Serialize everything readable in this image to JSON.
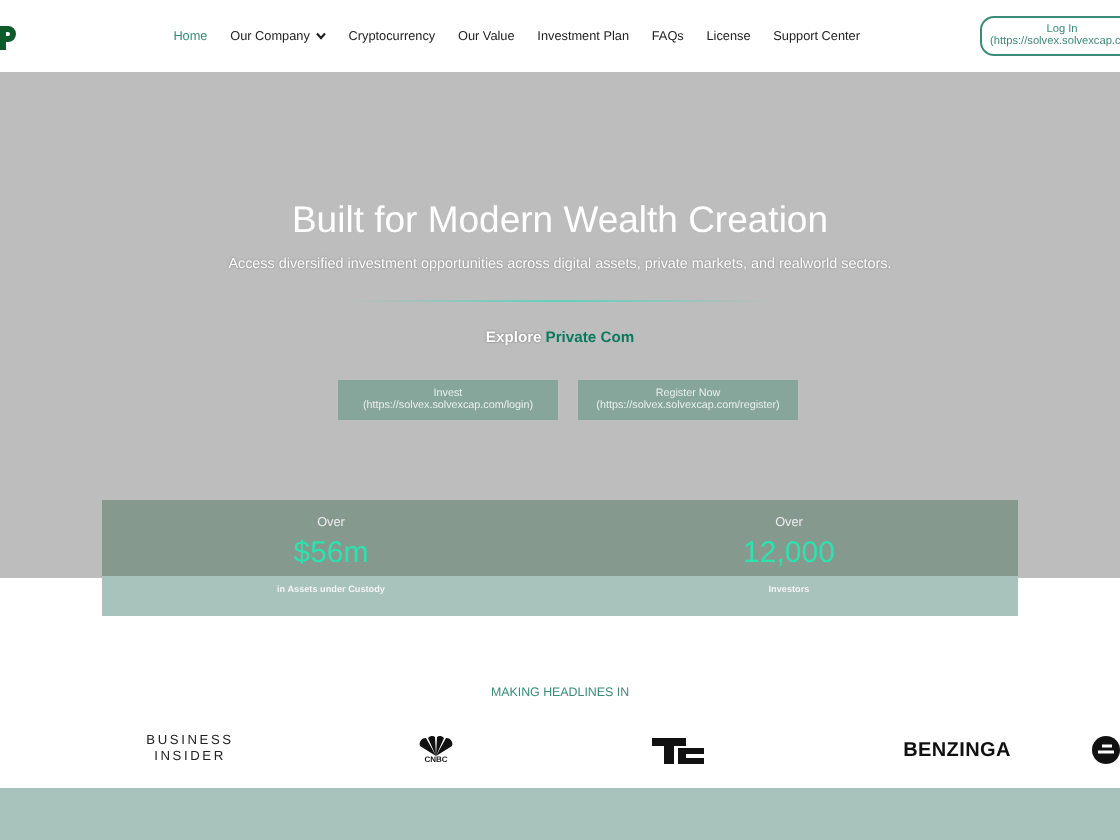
{
  "nav": {
    "items": [
      {
        "label": "Home",
        "selected": true,
        "dropdown": false
      },
      {
        "label": "Our Company",
        "selected": false,
        "dropdown": true
      },
      {
        "label": "Cryptocurrency",
        "selected": false,
        "dropdown": false
      },
      {
        "label": "Our Value",
        "selected": false,
        "dropdown": false
      },
      {
        "label": "Investment Plan",
        "selected": false,
        "dropdown": false
      },
      {
        "label": "FAQs",
        "selected": false,
        "dropdown": false
      },
      {
        "label": "License",
        "selected": false,
        "dropdown": false
      },
      {
        "label": "Support Center",
        "selected": false,
        "dropdown": false
      }
    ],
    "login": {
      "label": "Log In",
      "url": "(https://solvex.solvexcap.c"
    }
  },
  "hero": {
    "title": "Built for Modern Wealth Creation",
    "subtitle": "Access diversified investment opportunities across digital assets, private markets, and realworld sectors.",
    "explore": "Explore",
    "explore_highlight": "Private Com",
    "buttons": [
      {
        "label": "Invest",
        "url": "(https://solvex.solvexcap.com/login)"
      },
      {
        "label": "Register Now",
        "url": "(https://solvex.solvexcap.com/register)"
      }
    ]
  },
  "stats": [
    {
      "prefix": "Over",
      "value": "$56m",
      "caption": "in Assets under Custody"
    },
    {
      "prefix": "Over",
      "value": "12,000",
      "caption": "Investors"
    }
  ],
  "press": {
    "heading": "MAKING HEADLINES IN",
    "logos": [
      {
        "kind": "text2",
        "text": "BUSINESS INSIDER"
      },
      {
        "kind": "peacock",
        "text": "CNBC"
      },
      {
        "kind": "tc"
      },
      {
        "kind": "bold",
        "text": "BENZINGA"
      },
      {
        "kind": "circle"
      }
    ]
  }
}
